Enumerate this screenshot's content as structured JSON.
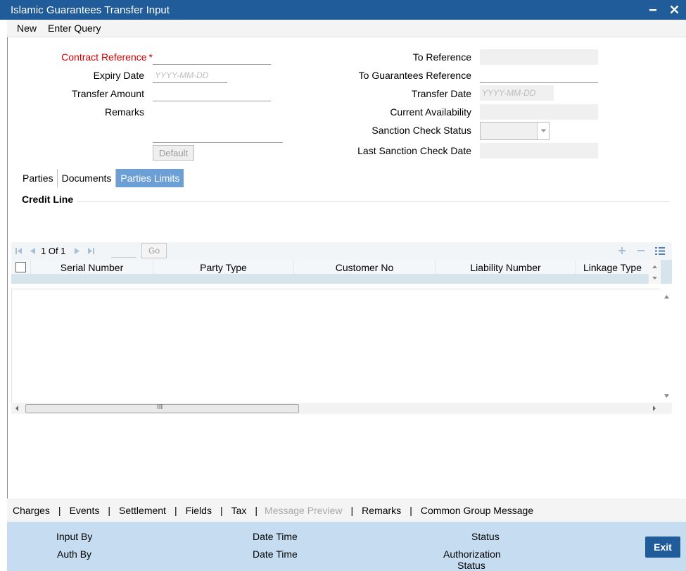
{
  "window": {
    "title": "Islamic Guarantees Transfer Input"
  },
  "menu": {
    "new": "New",
    "enter_query": "Enter Query"
  },
  "form": {
    "contract_reference": "Contract Reference",
    "required_mark": "*",
    "expiry_date": "Expiry Date",
    "transfer_amount": "Transfer Amount",
    "remarks": "Remarks",
    "date_placeholder": "YYYY-MM-DD",
    "default_button": "Default",
    "to_reference": "To Reference",
    "to_guarantees_reference": "To Guarantees Reference",
    "transfer_date": "Transfer Date",
    "current_availability": "Current Availability",
    "sanction_check_status": "Sanction Check Status",
    "last_sanction_check_date": "Last Sanction Check Date"
  },
  "tabs": [
    {
      "label": "Parties"
    },
    {
      "label": "Documents"
    },
    {
      "label": "Parties Limits",
      "active": true
    }
  ],
  "section": {
    "title": "Credit Line"
  },
  "grid": {
    "page_indicator": "1 Of 1",
    "go_label": "Go",
    "columns": [
      "Serial Number",
      "Party Type",
      "Customer No",
      "Liability Number",
      "Linkage Type"
    ],
    "scroll_grip": "III"
  },
  "bottom_links": [
    {
      "label": "Charges"
    },
    {
      "label": "Events"
    },
    {
      "label": "Settlement"
    },
    {
      "label": "Fields"
    },
    {
      "label": "Tax"
    },
    {
      "label": "Message Preview",
      "disabled": true
    },
    {
      "label": "Remarks"
    },
    {
      "label": "Common Group Message"
    }
  ],
  "footer": {
    "input_by": "Input By",
    "auth_by": "Auth By",
    "date_time_1": "Date Time",
    "date_time_2": "Date Time",
    "status": "Status",
    "authorization_status": "Authorization Status",
    "exit_label": "Exit"
  },
  "colors": {
    "title_bar": "#1f5c99",
    "active_tab": "#6b9fd6",
    "footer": "#c6ddf1",
    "required": "#d40000"
  }
}
